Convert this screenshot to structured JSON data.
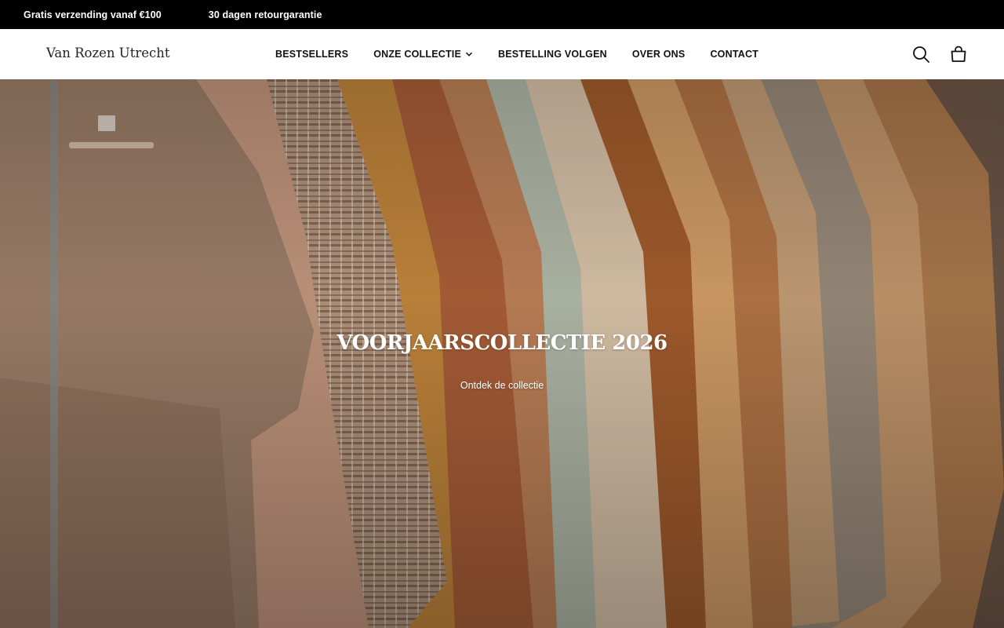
{
  "announcement": {
    "messages": [
      "Gratis verzending vanaf €100",
      "30 dagen retourgarantie"
    ]
  },
  "header": {
    "logo": "Van Rozen Utrecht",
    "nav": [
      {
        "label": "BESTSELLERS"
      },
      {
        "label": "ONZE COLLECTIE",
        "has_dropdown": true
      },
      {
        "label": "BESTELLING VOLGEN"
      },
      {
        "label": "OVER ONS"
      },
      {
        "label": "CONTACT"
      }
    ],
    "icons": {
      "search": "search-icon",
      "cart": "shopping-bag-icon",
      "dropdown": "chevron-down-icon"
    }
  },
  "hero": {
    "title": "VOORJAARSCOLLECTIE 2026",
    "cta": "Ontdek de collectie",
    "palette": [
      "#8a6a55",
      "#b5866a",
      "#c98a4f",
      "#a9653a",
      "#d8c7b3",
      "#bfa486",
      "#9a8a78",
      "#c3925f"
    ]
  },
  "colors": {
    "announcement_bg": "#000000",
    "header_bg": "#ffffff",
    "text": "#111111"
  }
}
